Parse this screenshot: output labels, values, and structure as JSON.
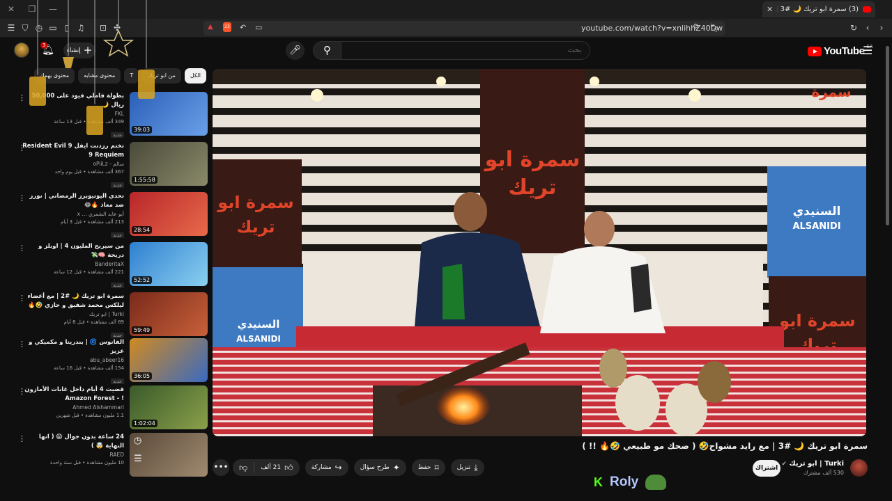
{
  "browser": {
    "tab_title": "(3) سمرة ابو تريك 🌙 #3 | مع را...",
    "url": "youtube.com/watch?v=xnlihhZ40Dw",
    "shield_count": "23"
  },
  "masthead": {
    "logo_text": "YouTube",
    "country_code": "SA",
    "search_placeholder": "بحث",
    "create_label": "إنشاء",
    "notif_count": "3"
  },
  "video": {
    "title": "سمرة ابو تريك 🌙 #3 | مع رايد مشواح🤣 ( ضحك مو طبيعي 🤣🔥 !! )",
    "channel_name": "Turki | ابو تريك",
    "channel_subs": "530 ألف مشترك",
    "subscribe_label": "اشتراك",
    "likes": "21 ألف",
    "share_label": "مشاركة",
    "ask_label": "طرح سؤال",
    "save_label": "حفظ",
    "download_label": "تنزيل",
    "set_words": {
      "sign_1": "سمرة ابو تريك",
      "sponsor_ar": "السنيدي",
      "sponsor_en": "ALSANIDI"
    }
  },
  "chips": [
    {
      "label": "الكل",
      "active": true
    },
    {
      "label": "من ابو تريك",
      "active": false
    },
    {
      "label": "T",
      "active": false
    },
    {
      "label": "محتوى مشابه",
      "active": false
    },
    {
      "label": "محتوى يهمك",
      "active": false
    }
  ],
  "recommendations": [
    {
      "title": "بطولة فاملي فيود على 50,000 ريال 🌙",
      "channel": "FKL",
      "stats": "349 ألف مشاهدة • قبل 13 ساعة",
      "badge": "جديد",
      "duration": "39:03",
      "thumb": "#2a5fb8"
    },
    {
      "title": "تختم رزدنت ايفل 9 Resident Evil 9 Requiem",
      "channel": "سالم - oPiiLz",
      "stats": "367 ألف مشاهدة • قبل يوم واحد",
      "badge": "جديد",
      "duration": "1:55:58",
      "thumb": "#4a4a3a"
    },
    {
      "title": "تحدي اليوتيوبرز الرمضاني | نورز ضد معاذ 🔥😂",
      "channel": "أبو عابد الشمري ... x",
      "stats": "213 ألف مشاهدة • قبل 3 أيام",
      "badge": "جديد",
      "duration": "28:54",
      "thumb": "#b8262a"
    },
    {
      "title": "من سيربح المليون 4 | اوبلز و دريحة 🧠💸",
      "channel": "BanderitaX",
      "stats": "221 ألف مشاهدة • قبل 12 ساعة",
      "badge": "جديد",
      "duration": "52:52",
      "thumb": "#2f7fd0"
    },
    {
      "title": "سمرة ابو تريك 🌙 #2 | مع أعضاء ليلكس محمد شفيق و حازي 🤣🔥 !!",
      "channel": "Turki | ابو تريك",
      "stats": "89 ألف مشاهدة • قبل 8 أيام",
      "badge": "جديد",
      "duration": "59:49",
      "thumb": "#7a2a1a"
    },
    {
      "title": "الفانوس 🌀 | بندريتا و مكميكي و عزيز",
      "channel": "abu_abeer16",
      "stats": "154 ألف مشاهدة • قبل 16 ساعة",
      "badge": "جديد",
      "duration": "36:05",
      "thumb": "#d08a20"
    },
    {
      "title": "قضيت 4 أيام داخل غابات الأمازون ! - Amazon Forest",
      "channel": "Ahmed Alshammari",
      "stats": "1.1 مليون مشاهدة • قبل شهرين",
      "badge": "",
      "duration": "1:02:04",
      "thumb": "#3a5a2a"
    },
    {
      "title": "24 ساعة بدون جوال 😱 ( انها النهاية 🤯 )",
      "channel": "RAED",
      "stats": "10 مليون مشاهدة • قبل سنة واحدة",
      "badge": "",
      "duration": "",
      "thumb": "#5a4a3a"
    }
  ],
  "overlay": {
    "kick_letter": "K",
    "streamer_name": "Roly"
  }
}
